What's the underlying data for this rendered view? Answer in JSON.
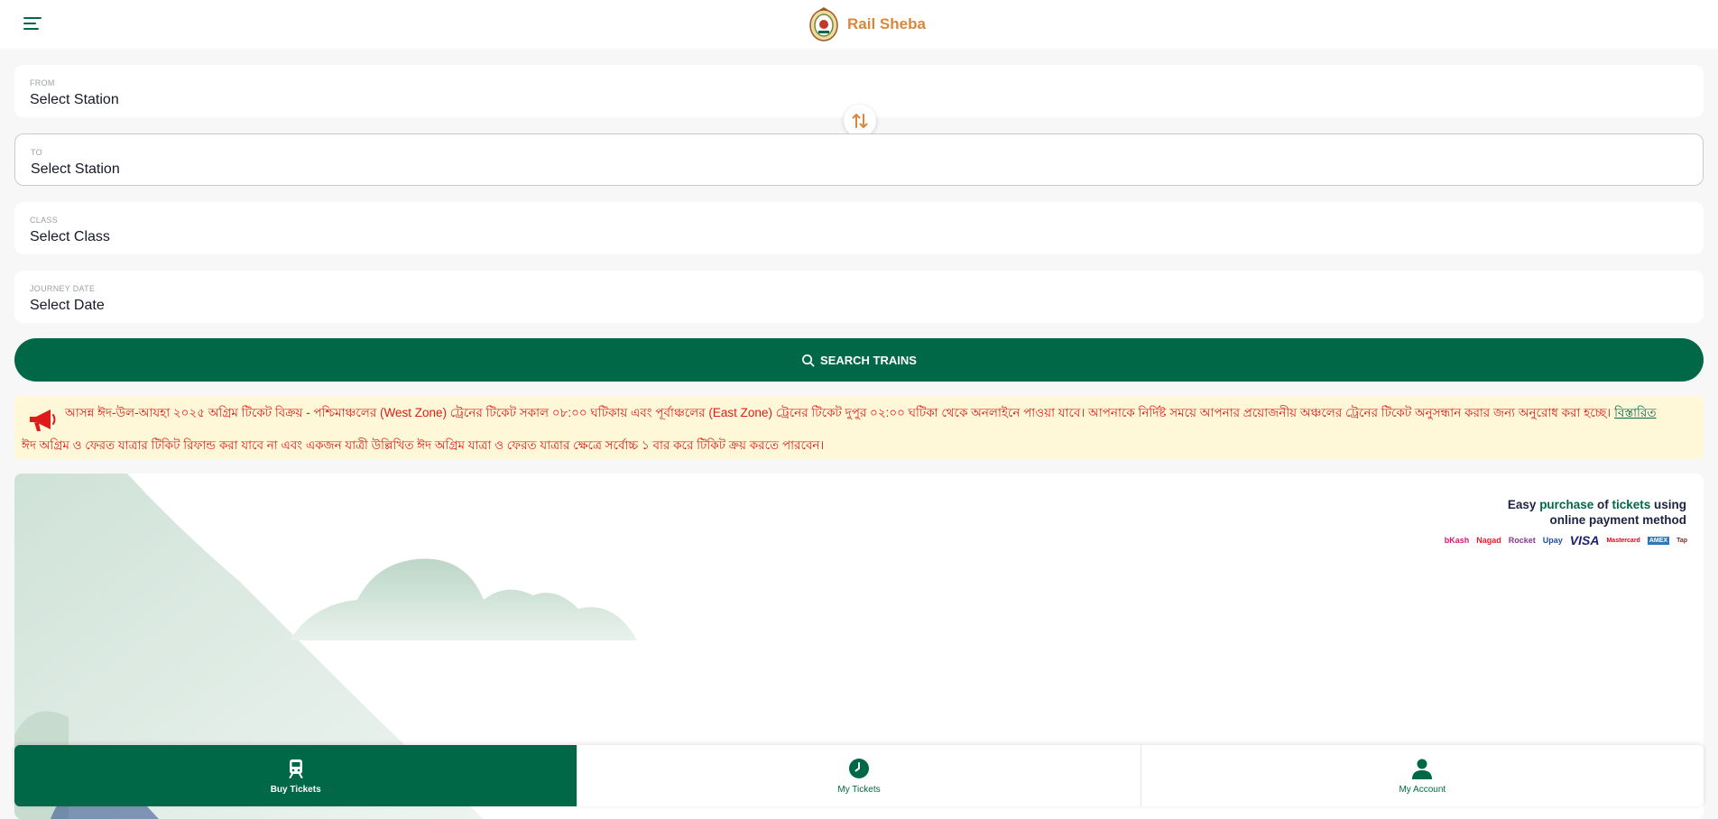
{
  "header": {
    "app_name": "Rail Sheba",
    "menu_icon": "hamburger-menu-icon",
    "logo_icon": "bangladesh-railway-emblem"
  },
  "form": {
    "from": {
      "label": "FROM",
      "value": "Select Station"
    },
    "to": {
      "label": "TO",
      "value": "Select Station"
    },
    "class": {
      "label": "CLASS",
      "value": "Select Class"
    },
    "journey_date": {
      "label": "JOURNEY DATE",
      "value": "Select Date"
    },
    "swap_icon": "swap-arrows-icon",
    "search_label": "SEARCH TRAINS",
    "search_icon": "search-icon"
  },
  "notice": {
    "line1": "আসন্ন ঈদ-উল-আযহা ২০২৫ অগ্রিম টিকেট বিক্রয় - পশ্চিমাঞ্চলের (West Zone) ট্রেনের টিকেট সকাল ০৮:০০ ঘটিকায় এবং পূর্বাঞ্চলের (East Zone) ট্রেনের টিকেট দুপুর ০২:০০ ঘটিকা থেকে অনলাইনে পাওয়া যাবে। আপনাকে নির্দিষ্ট সময়ে আপনার প্রয়োজনীয় অঞ্চলের ট্রেনের টিকেট অনুসন্ধান করার জন্য অনুরোধ করা হচ্ছে।",
    "link": "বিস্তারিত",
    "line2": "ঈদ অগ্রিম ও ফেরত যাত্রার টিকিট রিফান্ড করা যাবে না এবং একজন যাত্রী উল্লিখিত ঈদ অগ্রিম যাত্রা ও ফেরত যাত্রার ক্ষেত্রে সর্বোচ্চ ১ বার করে টিকিট ক্রয় করতে পারবেন।",
    "icon": "megaphone-icon"
  },
  "banner": {
    "text_part1": "Easy ",
    "text_highlight1": "purchase",
    "text_part2": " of ",
    "text_highlight2": "tickets",
    "text_part3": " using",
    "text_line2": "online payment method",
    "payment_methods": [
      "bKash",
      "Nagad",
      "Rocket",
      "Upay",
      "VISA",
      "Mastercard",
      "AMEX",
      "Tap"
    ]
  },
  "bottom_nav": {
    "items": [
      {
        "label": "Buy Tickets",
        "icon": "train-icon",
        "active": true
      },
      {
        "label": "My Tickets",
        "icon": "clock-icon",
        "active": false
      },
      {
        "label": "My Account",
        "icon": "user-icon",
        "active": false
      }
    ]
  },
  "colors": {
    "primary": "#006747",
    "brand": "#d8873c",
    "notice_bg": "#fff8d8",
    "notice_text": "#e01919"
  }
}
